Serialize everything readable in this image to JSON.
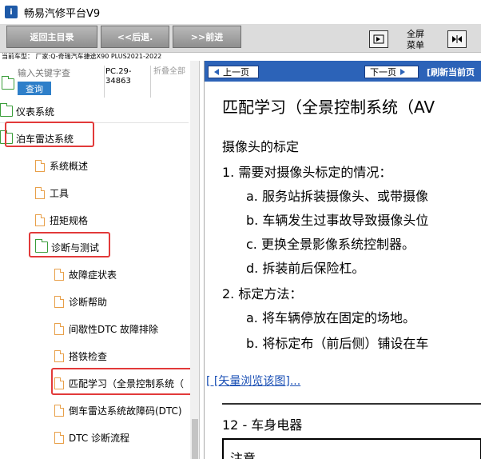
{
  "window": {
    "title": "畅易汽修平台V9",
    "logo_text": "i"
  },
  "toolbar": {
    "back_main": "返回主目录",
    "back": "<<后退.",
    "forward": ">>前进",
    "fullscreen_line1": "全屏",
    "fullscreen_line2": "菜单"
  },
  "vehicle_info": "当前车型： 厂家:Q-奇瑞汽车捷途X90 PLUS2021-2022",
  "search": {
    "placeholder": "输入关键字查",
    "button": "查询"
  },
  "pc_code": "PC.29-34863",
  "collapse_all": "折叠全部",
  "tree": [
    {
      "label": "仪表系统",
      "icon": "folder-icon"
    },
    {
      "label": "泊车雷达系统",
      "icon": "folder-icon"
    },
    {
      "label": "系统概述",
      "icon": "document-icon"
    },
    {
      "label": "工具",
      "icon": "document-icon"
    },
    {
      "label": "扭矩规格",
      "icon": "document-icon"
    },
    {
      "label": "诊断与测试",
      "icon": "folder-icon"
    },
    {
      "label": "故障症状表",
      "icon": "document-icon"
    },
    {
      "label": "诊断帮助",
      "icon": "document-icon"
    },
    {
      "label": "间歇性DTC 故障排除",
      "icon": "document-icon"
    },
    {
      "label": "搭铁检查",
      "icon": "document-icon"
    },
    {
      "label": "匹配学习（全景控制系统（",
      "icon": "document-icon"
    },
    {
      "label": "倒车雷达系统故障码(DTC)",
      "icon": "document-icon"
    },
    {
      "label": "DTC 诊断流程",
      "icon": "document-icon"
    }
  ],
  "content_nav": {
    "prev": "上一页",
    "next": "下一页",
    "refresh": "[刷新当前页"
  },
  "content": {
    "title": "匹配学习（全景控制系统（AV",
    "section": "摄像头的标定",
    "item1": "1.  需要对摄像头标定的情况：",
    "item1a": "a.  服务站拆装摄像头、或带摄像",
    "item1b": "b.  车辆发生过事故导致摄像头位",
    "item1c": "c.  更换全景影像系统控制器。",
    "item1d": "d.  拆装前后保险杠。",
    "item2": "2.  标定方法：",
    "item2a": "a.  将车辆停放在固定的场地。",
    "item2b": "b.  将标定布（前后侧）铺设在车",
    "vector_link": "[ [矢量浏览该图]...",
    "chapter": "12 - 车身电器",
    "notice": "注意"
  },
  "colors": {
    "nav_blue": "#2c63b8",
    "highlight_red": "#e23a3a",
    "folder_green": "#3a9d3a",
    "doc_orange": "#e8a04a",
    "search_blue": "#2e7fc9"
  }
}
